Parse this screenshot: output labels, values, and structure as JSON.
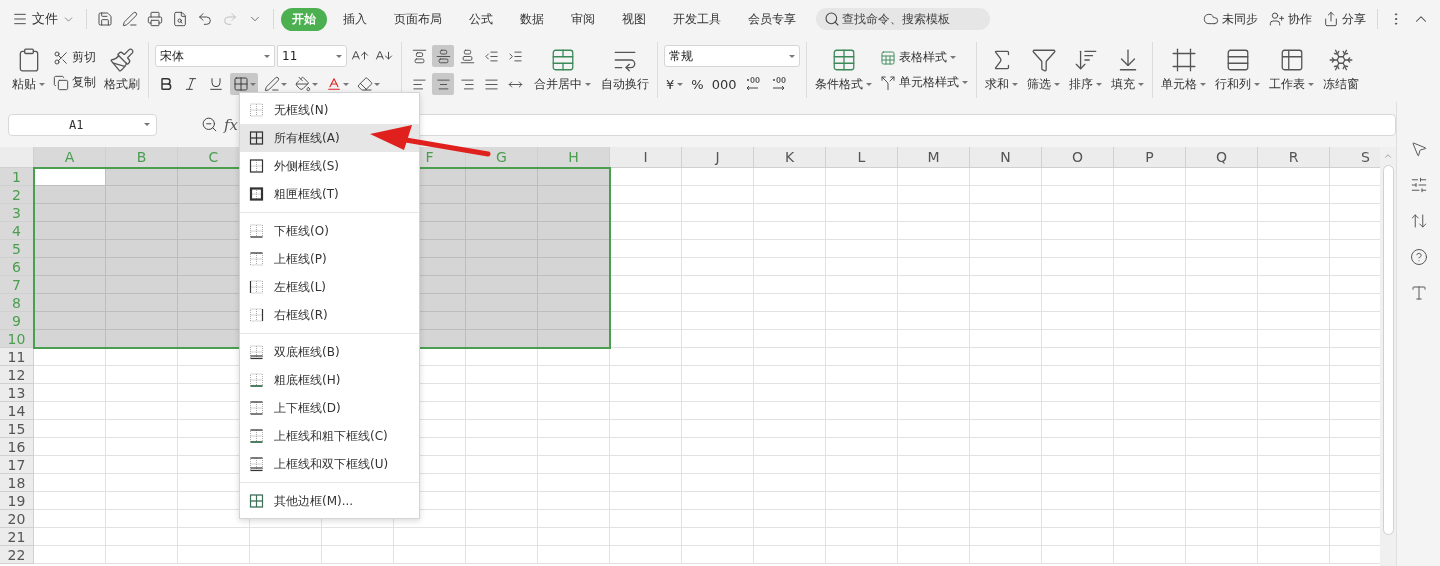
{
  "menu_bar": {
    "file_menu": "文件",
    "tabs": [
      {
        "label": "开始",
        "selected": true
      },
      {
        "label": "插入",
        "selected": false
      },
      {
        "label": "页面布局",
        "selected": false
      },
      {
        "label": "公式",
        "selected": false
      },
      {
        "label": "数据",
        "selected": false
      },
      {
        "label": "审阅",
        "selected": false
      },
      {
        "label": "视图",
        "selected": false
      },
      {
        "label": "开发工具",
        "selected": false
      },
      {
        "label": "会员专享",
        "selected": false
      }
    ],
    "search": {
      "placeholder": "查找命令、搜索模板"
    },
    "actions": [
      {
        "label": "未同步",
        "kind": "sync"
      },
      {
        "label": "协作",
        "kind": "collab"
      },
      {
        "label": "分享",
        "kind": "share"
      }
    ]
  },
  "ribbon": {
    "clipboard": {
      "paste": "粘贴",
      "cut": "剪切",
      "copy": "复制",
      "painter": "格式刷"
    },
    "font": {
      "name": "宋体",
      "size": "11",
      "border_menu_open": true
    },
    "alignment": {
      "row_1": [
        {
          "kind": "top",
          "selected": false
        },
        {
          "kind": "middle",
          "selected": true
        },
        {
          "kind": "bottom",
          "selected": false
        },
        {
          "kind": "outdent",
          "selected": false
        },
        {
          "kind": "indent",
          "selected": false
        }
      ],
      "row_2": [
        {
          "kind": "left",
          "selected": false
        },
        {
          "kind": "center",
          "selected": true
        },
        {
          "kind": "right",
          "selected": false
        },
        {
          "kind": "justify",
          "selected": false
        },
        {
          "kind": "distribute",
          "selected": false
        }
      ],
      "merge": "合并居中",
      "wrap": "自动换行"
    },
    "number": {
      "format": "常规",
      "currency": "¥",
      "percent": "%",
      "thousands": "000"
    },
    "styles": {
      "conditional": "条件格式",
      "table_style": "表格样式",
      "cell_style": "单元格样式"
    },
    "tools": [
      {
        "label": "求和",
        "kind": "sum",
        "has_menu": true
      },
      {
        "label": "筛选",
        "kind": "filter",
        "has_menu": true
      },
      {
        "label": "排序",
        "kind": "sort",
        "has_menu": true
      },
      {
        "label": "填充",
        "kind": "fill",
        "has_menu": true
      }
    ],
    "cells": [
      {
        "label": "单元格",
        "kind": "cell",
        "has_menu": true
      },
      {
        "label": "行和列",
        "kind": "rowcol",
        "has_menu": true
      },
      {
        "label": "工作表",
        "kind": "sheet",
        "has_menu": true
      },
      {
        "label": "冻结窗",
        "kind": "freeze",
        "has_menu": false
      }
    ]
  },
  "formula_bar": {
    "name_box": "A1",
    "function_label": "fx"
  },
  "sheet": {
    "columns_left": [
      {
        "label": "A",
        "selected": true,
        "active": true
      },
      {
        "label": "B",
        "selected": true,
        "active": false
      },
      {
        "label": "C",
        "selected": true,
        "active": false
      }
    ],
    "columns_right": [
      {
        "label": "F",
        "selected": true,
        "active": false
      },
      {
        "label": "G",
        "selected": true,
        "active": false
      },
      {
        "label": "H",
        "selected": true,
        "active": false
      },
      {
        "label": "I",
        "selected": false,
        "active": false
      },
      {
        "label": "J",
        "selected": false,
        "active": false
      },
      {
        "label": "K",
        "selected": false,
        "active": false
      },
      {
        "label": "L",
        "selected": false,
        "active": false
      },
      {
        "label": "M",
        "selected": false,
        "active": false
      },
      {
        "label": "N",
        "selected": false,
        "active": false
      },
      {
        "label": "O",
        "selected": false,
        "active": false
      },
      {
        "label": "P",
        "selected": false,
        "active": false
      },
      {
        "label": "Q",
        "selected": false,
        "active": false
      },
      {
        "label": "R",
        "selected": false,
        "active": false
      },
      {
        "label": "S",
        "selected": false,
        "active": false
      }
    ],
    "rows": [
      {
        "label": "1",
        "selected": true,
        "active": true
      },
      {
        "label": "2",
        "selected": true,
        "active": false
      },
      {
        "label": "3",
        "selected": true,
        "active": false
      },
      {
        "label": "4",
        "selected": true,
        "active": false
      },
      {
        "label": "5",
        "selected": true,
        "active": false
      },
      {
        "label": "6",
        "selected": true,
        "active": false
      },
      {
        "label": "7",
        "selected": true,
        "active": false
      },
      {
        "label": "8",
        "selected": true,
        "active": false
      },
      {
        "label": "9",
        "selected": true,
        "active": false
      },
      {
        "label": "10",
        "selected": true,
        "active": false
      },
      {
        "label": "11",
        "selected": false,
        "active": false
      },
      {
        "label": "12",
        "selected": false,
        "active": false
      },
      {
        "label": "13",
        "selected": false,
        "active": false
      },
      {
        "label": "14",
        "selected": false,
        "active": false
      },
      {
        "label": "15",
        "selected": false,
        "active": false
      },
      {
        "label": "16",
        "selected": false,
        "active": false
      },
      {
        "label": "17",
        "selected": false,
        "active": false
      },
      {
        "label": "18",
        "selected": false,
        "active": false
      },
      {
        "label": "19",
        "selected": false,
        "active": false
      },
      {
        "label": "20",
        "selected": false,
        "active": false
      },
      {
        "label": "21",
        "selected": false,
        "active": false
      },
      {
        "label": "22",
        "selected": false,
        "active": false
      }
    ]
  },
  "border_menu": {
    "groups": [
      [
        {
          "label": "无框线(N)",
          "kind": "none",
          "selected": false
        },
        {
          "label": "所有框线(A)",
          "kind": "all",
          "selected": true
        },
        {
          "label": "外侧框线(S)",
          "kind": "outside",
          "selected": false
        },
        {
          "label": "粗匣框线(T)",
          "kind": "thick",
          "selected": false
        }
      ],
      [
        {
          "label": "下框线(O)",
          "kind": "bottom",
          "selected": false
        },
        {
          "label": "上框线(P)",
          "kind": "top",
          "selected": false
        },
        {
          "label": "左框线(L)",
          "kind": "left",
          "selected": false
        },
        {
          "label": "右框线(R)",
          "kind": "right",
          "selected": false
        }
      ],
      [
        {
          "label": "双底框线(B)",
          "kind": "double-bottom",
          "selected": false
        },
        {
          "label": "粗底框线(H)",
          "kind": "thick-bottom",
          "selected": false
        },
        {
          "label": "上下框线(D)",
          "kind": "top-bottom",
          "selected": false
        },
        {
          "label": "上框线和粗下框线(C)",
          "kind": "top-thick-bottom",
          "selected": false
        },
        {
          "label": "上框线和双下框线(U)",
          "kind": "top-double-bottom",
          "selected": false
        }
      ],
      [
        {
          "label": "其他边框(M)...",
          "kind": "more",
          "selected": false
        }
      ]
    ]
  }
}
